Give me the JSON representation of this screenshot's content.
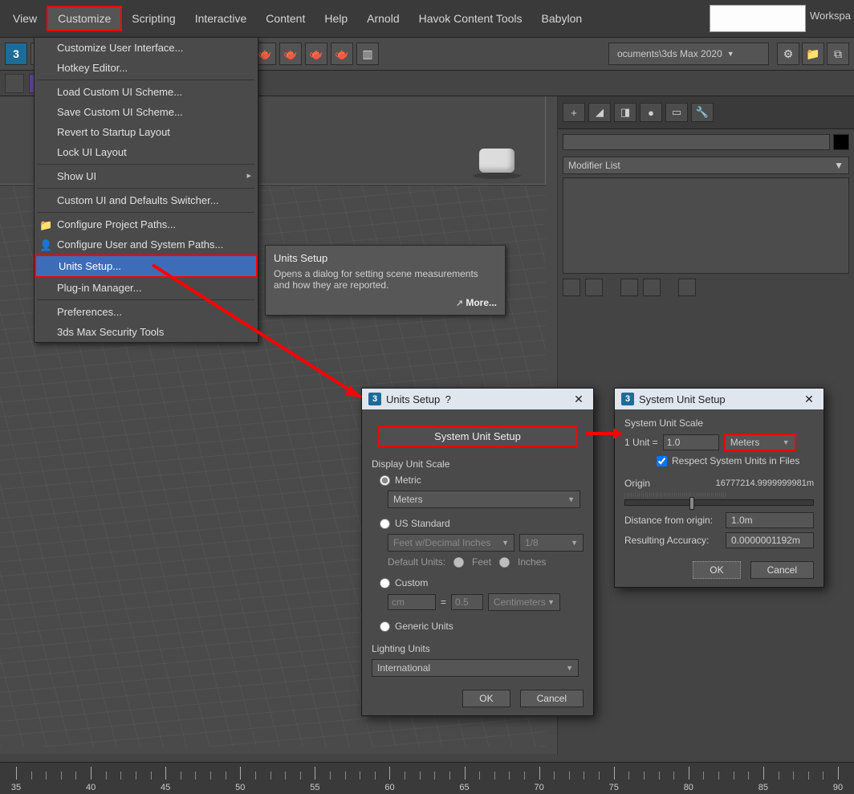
{
  "menubar": {
    "items": [
      "View",
      "Customize",
      "Scripting",
      "Interactive",
      "Content",
      "Help",
      "Arnold",
      "Havok Content Tools",
      "Babylon"
    ],
    "highlighted_index": 1,
    "workspace": "Workspa",
    "project_path": "ocuments\\3ds Max 2020"
  },
  "dropdown": {
    "items": [
      {
        "label": "Customize User Interface...",
        "type": "item"
      },
      {
        "label": "Hotkey Editor...",
        "type": "item"
      },
      {
        "type": "sep"
      },
      {
        "label": "Load Custom UI Scheme...",
        "type": "item"
      },
      {
        "label": "Save Custom UI Scheme...",
        "type": "item"
      },
      {
        "label": "Revert to Startup Layout",
        "type": "item"
      },
      {
        "label": "Lock UI Layout",
        "type": "item"
      },
      {
        "type": "sep"
      },
      {
        "label": "Show UI",
        "type": "sub"
      },
      {
        "type": "sep"
      },
      {
        "label": "Custom UI and Defaults Switcher...",
        "type": "item"
      },
      {
        "type": "sep"
      },
      {
        "label": "Configure Project Paths...",
        "type": "item",
        "icon": true
      },
      {
        "label": "Configure User and System Paths...",
        "type": "item",
        "icon": true
      },
      {
        "label": "Units Setup...",
        "type": "hot"
      },
      {
        "label": "Plug-in Manager...",
        "type": "item"
      },
      {
        "type": "sep"
      },
      {
        "label": "Preferences...",
        "type": "item"
      },
      {
        "label": "3ds Max Security Tools",
        "type": "item"
      }
    ]
  },
  "tooltip": {
    "title": "Units Setup",
    "body": "Opens a dialog for setting scene measurements and how they are reported.",
    "more": "More..."
  },
  "right_panel": {
    "modifier_list": "Modifier List"
  },
  "units_dialog": {
    "title": "Units Setup",
    "system_btn": "System Unit Setup",
    "display_label": "Display Unit Scale",
    "metric_label": "Metric",
    "metric_value": "Meters",
    "us_label": "US Standard",
    "us_value": "Feet w/Decimal Inches",
    "us_frac": "1/8",
    "default_units": "Default Units:",
    "feet": "Feet",
    "inches": "Inches",
    "custom_label": "Custom",
    "custom_unit": "cm",
    "custom_eq": "=",
    "custom_val": "0.5",
    "custom_sys": "Centimeters",
    "generic_label": "Generic Units",
    "lighting_label": "Lighting Units",
    "lighting_value": "International",
    "ok": "OK",
    "cancel": "Cancel"
  },
  "system_dialog": {
    "title": "System Unit Setup",
    "scale_label": "System Unit Scale",
    "unit_prefix": "1 Unit =",
    "unit_value": "1.0",
    "unit_type": "Meters",
    "respect": "Respect System Units in Files",
    "origin_label": "Origin",
    "origin_value": "16777214.9999999981m",
    "distance_label": "Distance from origin:",
    "distance_value": "1.0m",
    "accuracy_label": "Resulting Accuracy:",
    "accuracy_value": "0.0000001192m",
    "ok": "OK",
    "cancel": "Cancel"
  },
  "timeline": {
    "labels": [
      "35",
      "40",
      "45",
      "50",
      "55",
      "60",
      "65",
      "70",
      "75",
      "80",
      "85",
      "90"
    ]
  }
}
